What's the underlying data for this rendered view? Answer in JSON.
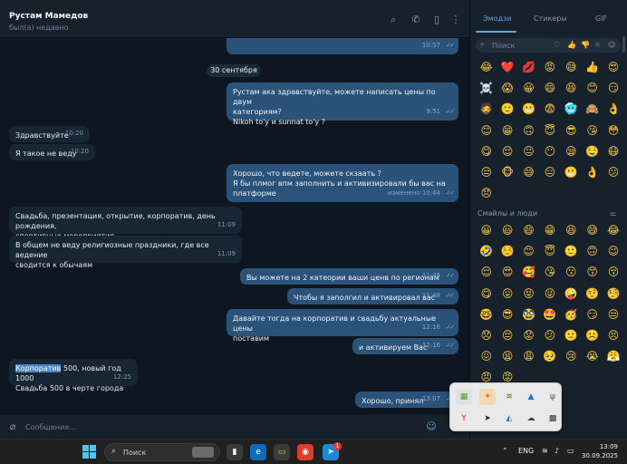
{
  "header": {
    "name": "Рустам Мамедов",
    "status": "был(а) недавно"
  },
  "chat": {
    "top_message_time": "10:57",
    "date_chip": "30 сентября",
    "messages": [
      {
        "dir": "out",
        "lines": [
          "Рустам ака здравствуйте, можете написать цены по двум",
          "категориям?",
          "Nikoh to'y и sunnat to'y ?"
        ],
        "time": "9:51"
      },
      {
        "dir": "in",
        "lines": [
          "Здравствуйте"
        ],
        "time": "10:20"
      },
      {
        "dir": "in",
        "lines": [
          "Я такое не веду"
        ],
        "time": "10:20"
      },
      {
        "dir": "out",
        "lines": [
          "Хорошо, что ведете, можете скзаать ?",
          "Я бы плмог впм заполнить и активизировали бы вас на",
          "платформе"
        ],
        "time": "изменено 10:44"
      },
      {
        "dir": "in",
        "lines": [
          "Свадьба, презентация, открытие, корпоратив, день рождения,",
          "спортивные мероприятия"
        ],
        "time": "11:09"
      },
      {
        "dir": "in",
        "lines": [
          "В общем не веду религиозные праздники, где все ведение",
          "сводится к обычаям"
        ],
        "time": "11:09"
      },
      {
        "dir": "out",
        "lines": [
          "Вы можете на 2 катеории ваши ценв по  регионам"
        ],
        "time": "11:48"
      },
      {
        "dir": "out",
        "lines": [
          "Чтобы я заполгил и активировал вас"
        ],
        "time": "11:48"
      },
      {
        "dir": "out",
        "lines": [
          "Давайте тогда на корпоратив и свадьбу актуальные цены",
          "поставим"
        ],
        "time": "12:16"
      },
      {
        "dir": "out",
        "lines": [
          "и активируем Вас"
        ],
        "time": "12:16"
      },
      {
        "dir": "in",
        "highlight": "Корпоратив",
        "lines": [
          " 500, новый год 1000",
          "Свадьба 500 в черте города"
        ],
        "time": "12:25"
      },
      {
        "dir": "out",
        "lines": [
          "Хорошо, принял"
        ],
        "time": "13:07"
      }
    ]
  },
  "compose": {
    "placeholder": "Сообщение..."
  },
  "emoji_panel": {
    "tabs": [
      "Эмодзи",
      "Стикеры",
      "GIF"
    ],
    "search_placeholder": "Поиск",
    "section_title": "Смайлы и люди",
    "recent": [
      "😂",
      "❤️",
      "💋",
      "😡",
      "😅",
      "👍",
      "😍",
      "☠️",
      "😱",
      "😀",
      "😄",
      "😆",
      "😊",
      "😏",
      "🧔",
      "🙂",
      "😬",
      "😨",
      "🥶",
      "🙈",
      "👌",
      "😊",
      "😁",
      "🙃",
      "😇",
      "😎",
      "😘",
      "😳",
      "😋",
      "😌",
      "😐",
      "😶",
      "😪",
      "🤤",
      "😷",
      "😒",
      "🐵",
      "😅",
      "😑",
      "😬",
      "👌",
      "😕",
      "😞"
    ],
    "smileys": [
      "😀",
      "😃",
      "😄",
      "😁",
      "😆",
      "😅",
      "😂",
      "🤣",
      "☺️",
      "😊",
      "😇",
      "🙂",
      "🙃",
      "😉",
      "😌",
      "😍",
      "🥰",
      "😘",
      "😗",
      "😙",
      "😚",
      "😋",
      "😛",
      "😝",
      "😜",
      "🤪",
      "🤨",
      "🧐",
      "🤓",
      "😎",
      "🥸",
      "🤩",
      "🥳",
      "😏",
      "😒",
      "😞",
      "😔",
      "😟",
      "😕",
      "🙁",
      "☹️",
      "😣",
      "😖",
      "😫",
      "😩",
      "🥺",
      "😢",
      "😭",
      "😤",
      "😠",
      "😡"
    ]
  },
  "tray_popup": {
    "icons": [
      "nvidia-icon",
      "app-orange-icon",
      "stack-icon",
      "usb-icon",
      "yandex-icon",
      "telegram-icon",
      "drive-icon",
      "cloud-icon",
      "grid-icon",
      "pen-icon"
    ]
  },
  "taskbar": {
    "search_placeholder": "Поиск",
    "language": "ENG",
    "time": "13:09",
    "date": "30.09.2025",
    "telegram_badge": "1"
  }
}
